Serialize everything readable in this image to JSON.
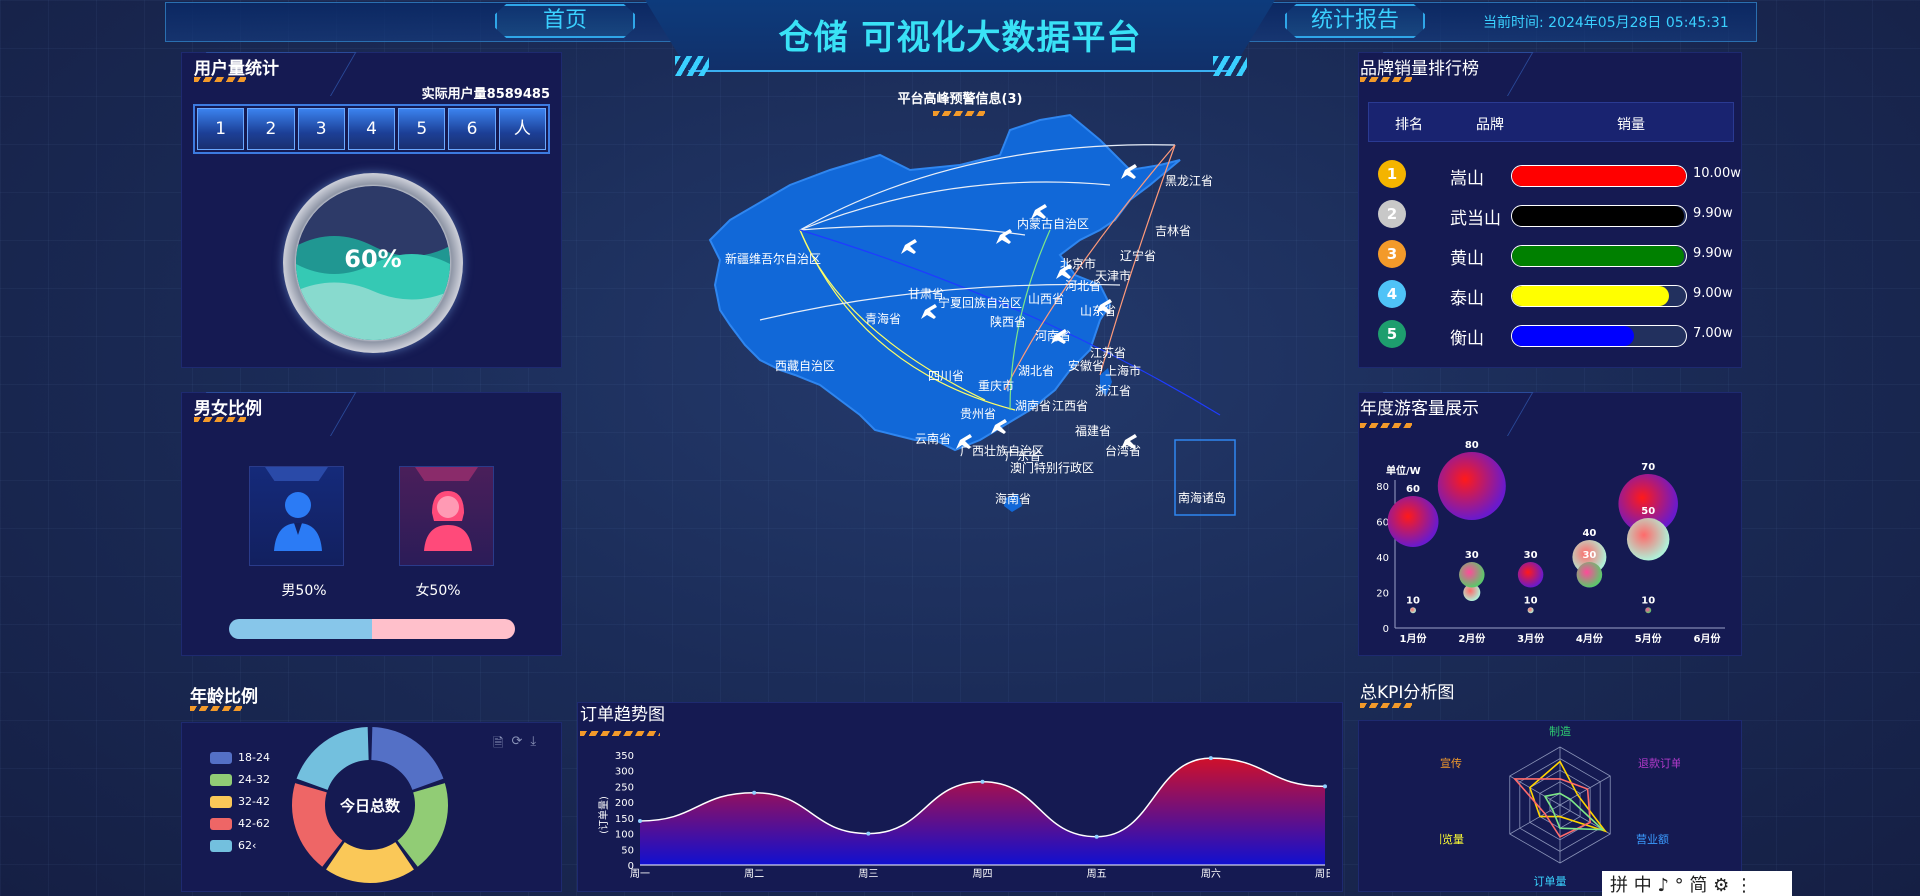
{
  "header": {
    "title": "仓储 可视化大数据平台",
    "nav_home": "首页",
    "nav_report": "统计报告",
    "clock": "当前时间: 2024年05月28日 05:45:31",
    "alert": "平台高峰预警信息(3)"
  },
  "user_stats": {
    "title": "用户量统计",
    "actual_label": "实际用户量8589485",
    "digits": [
      "1",
      "2",
      "3",
      "4",
      "5",
      "6",
      "人"
    ],
    "gauge_percent": 60,
    "gauge_label": "60%"
  },
  "gender": {
    "title": "男女比例",
    "male_label": "男50%",
    "female_label": "女50%",
    "male_ratio": 0.5,
    "male_color": "#2b7bf5",
    "female_color": "#ff4a7a"
  },
  "age": {
    "title": "年龄比例",
    "center_label": "今日总数",
    "toolbar": [
      "file-icon",
      "refresh-icon",
      "download-icon"
    ],
    "chart_data": {
      "type": "pie",
      "categories": [
        "18-24",
        "24-32",
        "32-42",
        "42-62",
        "62+"
      ],
      "legend_labels": [
        "18-24",
        "24-32",
        "32-42",
        "42-62",
        "62‹"
      ],
      "values": [
        20,
        20,
        20,
        20,
        20
      ],
      "colors": [
        "#5470c6",
        "#91cc75",
        "#fac858",
        "#ee6666",
        "#73c0de"
      ]
    }
  },
  "map": {
    "provinces": [
      "黑龙江省",
      "吉林省",
      "辽宁省",
      "内蒙古自治区",
      "北京市",
      "天津市",
      "河北省",
      "山东省",
      "新疆维吾尔自治区",
      "甘肃省",
      "宁夏回族自治区",
      "山西省",
      "陕西省",
      "青海省",
      "河南省",
      "江苏省",
      "安徽省",
      "上海市",
      "西藏自治区",
      "四川省",
      "湖北省",
      "浙江省",
      "重庆市",
      "湖南省",
      "江西省",
      "贵州省",
      "福建省",
      "云南省",
      "广西壮族自治区",
      "广东省",
      "台湾省",
      "澳门特别行政区",
      "海南省",
      "南海诸岛"
    ]
  },
  "orders": {
    "title": "订单趋势图",
    "chart_data": {
      "type": "area",
      "categories": [
        "周一",
        "周二",
        "周三",
        "周四",
        "周五",
        "周六",
        "周日"
      ],
      "values": [
        140,
        230,
        100,
        265,
        90,
        340,
        250
      ],
      "ylim": [
        0,
        350
      ],
      "yticks": [
        0,
        50,
        100,
        150,
        200,
        250,
        300,
        350
      ],
      "ylabel": "(订单量)"
    }
  },
  "brand_rank": {
    "title": "品牌销量排行榜",
    "headers": [
      "排名",
      "品牌",
      "销量"
    ],
    "rows": [
      {
        "rank": "1",
        "name": "嵩山",
        "value": "10.00w",
        "ratio": 1.0,
        "color": "#ff0000",
        "medal": "#f4b400"
      },
      {
        "rank": "2",
        "name": "武当山",
        "value": "9.90w",
        "ratio": 0.99,
        "color": "#000000",
        "medal": "#c8c8c8"
      },
      {
        "rank": "3",
        "name": "黄山",
        "value": "9.90w",
        "ratio": 0.99,
        "color": "#008000",
        "medal": "#f39a2a"
      },
      {
        "rank": "4",
        "name": "泰山",
        "value": "9.00w",
        "ratio": 0.9,
        "color": "#ffff00",
        "medal": "#4fc3f7"
      },
      {
        "rank": "5",
        "name": "衡山",
        "value": "7.00w",
        "ratio": 0.7,
        "color": "#0000ff",
        "medal": "#1e9e6e"
      }
    ]
  },
  "tourists": {
    "title": "年度游客量展示",
    "chart_data": {
      "type": "scatter",
      "unit": "单位/W",
      "categories": [
        "1月份",
        "2月份",
        "3月份",
        "4月份",
        "5月份",
        "6月份"
      ],
      "ylim": [
        0,
        80
      ],
      "yticks": [
        0,
        20,
        40,
        60,
        80
      ],
      "series": [
        {
          "values": [
            60,
            80,
            30,
            30,
            70,
            null
          ]
        },
        {
          "values": [
            10,
            20,
            10,
            40,
            50,
            null
          ]
        },
        {
          "values": [
            null,
            30,
            null,
            30,
            10,
            null
          ]
        }
      ]
    }
  },
  "kpi": {
    "title": "总KPI分析图",
    "chart_data": {
      "type": "radar",
      "indicators": [
        "制造",
        "退款订单",
        "营业额",
        "订单量",
        "浏览量",
        "宣传"
      ],
      "indicator_colors": [
        "#2ecc71",
        "#b03ac9",
        "#3a9bff",
        "#39d3ff",
        "#ffff33",
        "#f39a2a"
      ],
      "series": [
        {
          "values": [
            0.75,
            0.35,
            0.9,
            0.2,
            0.4,
            0.6
          ],
          "color": "#ffd400"
        },
        {
          "values": [
            0.45,
            0.55,
            0.6,
            0.55,
            0.3,
            0.9
          ],
          "color": "#ff6a6a"
        },
        {
          "values": [
            0.2,
            0.2,
            0.85,
            0.4,
            0.15,
            0.3
          ],
          "color": "#7ee787"
        }
      ]
    }
  },
  "ime": {
    "label": "拼 中 ♪ ° 简 ⚙ ⋮"
  }
}
